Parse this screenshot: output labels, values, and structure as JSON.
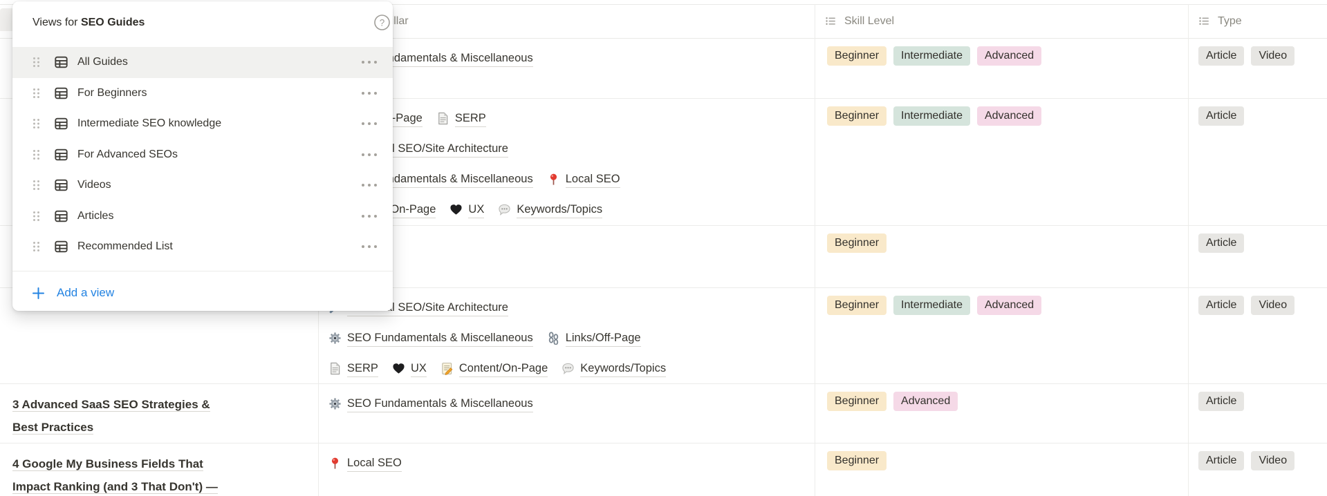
{
  "view_menu": {
    "title": {
      "prefix": "Views for ",
      "subject": "SEO Guides"
    },
    "items": [
      {
        "label": "All Guides",
        "active": true
      },
      {
        "label": "For Beginners",
        "active": false
      },
      {
        "label": "Intermediate SEO knowledge",
        "active": false
      },
      {
        "label": "For Advanced SEOs",
        "active": false
      },
      {
        "label": "Videos",
        "active": false
      },
      {
        "label": "Articles",
        "active": false
      },
      {
        "label": "Recommended List",
        "active": false
      }
    ],
    "add_view_label": "Add a view",
    "accent_color": "#2383e2"
  },
  "table": {
    "headers": {
      "pillar": "Pillar",
      "skill": "Skill Level",
      "type": "Type"
    },
    "rows": [
      {
        "title_lines": [],
        "pillar_lines": [
          [
            {
              "icon": "gear",
              "text": "SEO Fundamentals & Miscellaneous"
            }
          ]
        ],
        "skill_level": [
          "Beginner",
          "Intermediate",
          "Advanced"
        ],
        "type": [
          "Article",
          "Video"
        ]
      },
      {
        "title_lines": [],
        "pillar_lines": [
          [
            {
              "icon": "chains",
              "text": "Links/Off-Page"
            },
            {
              "icon": "page",
              "text": "SERP"
            }
          ],
          [
            {
              "icon": "wrench",
              "text": "Technical SEO/Site Architecture"
            }
          ],
          [
            {
              "icon": "gear",
              "text": "SEO Fundamentals & Miscellaneous"
            },
            {
              "icon": "pin",
              "text": "Local SEO"
            }
          ],
          [
            {
              "icon": "memo",
              "text": "Content/On-Page"
            },
            {
              "icon": "heart",
              "text": "UX"
            },
            {
              "icon": "speech",
              "text": "Keywords/Topics"
            }
          ]
        ],
        "skill_level": [
          "Beginner",
          "Intermediate",
          "Advanced"
        ],
        "type": [
          "Article"
        ]
      },
      {
        "title_lines": [],
        "pillar_lines": [],
        "skill_level": [
          "Beginner"
        ],
        "type": [
          "Article"
        ]
      },
      {
        "title_lines": [],
        "pillar_lines": [
          [
            {
              "icon": "wrench",
              "text": "Technical SEO/Site Architecture"
            }
          ],
          [
            {
              "icon": "gear",
              "text": "SEO Fundamentals & Miscellaneous"
            },
            {
              "icon": "chains",
              "text": "Links/Off-Page"
            }
          ],
          [
            {
              "icon": "page",
              "text": "SERP"
            },
            {
              "icon": "heart",
              "text": "UX"
            },
            {
              "icon": "memo",
              "text": "Content/On-Page"
            },
            {
              "icon": "speech",
              "text": "Keywords/Topics"
            }
          ]
        ],
        "skill_level": [
          "Beginner",
          "Intermediate",
          "Advanced"
        ],
        "type": [
          "Article",
          "Video"
        ]
      },
      {
        "title_lines": [
          "3 Advanced SaaS SEO Strategies &",
          "Best Practices"
        ],
        "pillar_lines": [
          [
            {
              "icon": "gear",
              "text": "SEO Fundamentals & Miscellaneous"
            }
          ]
        ],
        "skill_level": [
          "Beginner",
          "Advanced"
        ],
        "type": [
          "Article"
        ]
      },
      {
        "title_lines": [
          "4 Google My Business Fields That",
          "Impact Ranking (and 3 That Don't) —"
        ],
        "pillar_lines": [
          [
            {
              "icon": "pin",
              "text": "Local SEO"
            }
          ]
        ],
        "skill_level": [
          "Beginner"
        ],
        "type": [
          "Article",
          "Video"
        ]
      }
    ],
    "tag_colors": {
      "Beginner": {
        "bg": "#f9e9ca"
      },
      "Intermediate": {
        "bg": "#d5e4dc"
      },
      "Advanced": {
        "bg": "#f5d9e7"
      },
      "Article": {
        "bg": "#e7e6e3"
      },
      "Video": {
        "bg": "#e7e6e3"
      }
    }
  },
  "icon_names": [
    "gear-icon",
    "chains-icon",
    "page-icon",
    "pin-icon",
    "black-heart-icon",
    "memo-icon",
    "speech-balloon-icon",
    "wrench-icon",
    "table-view-icon",
    "drag-handle-icon",
    "more-dots-icon",
    "help-icon",
    "plus-icon",
    "list-property-icon"
  ]
}
